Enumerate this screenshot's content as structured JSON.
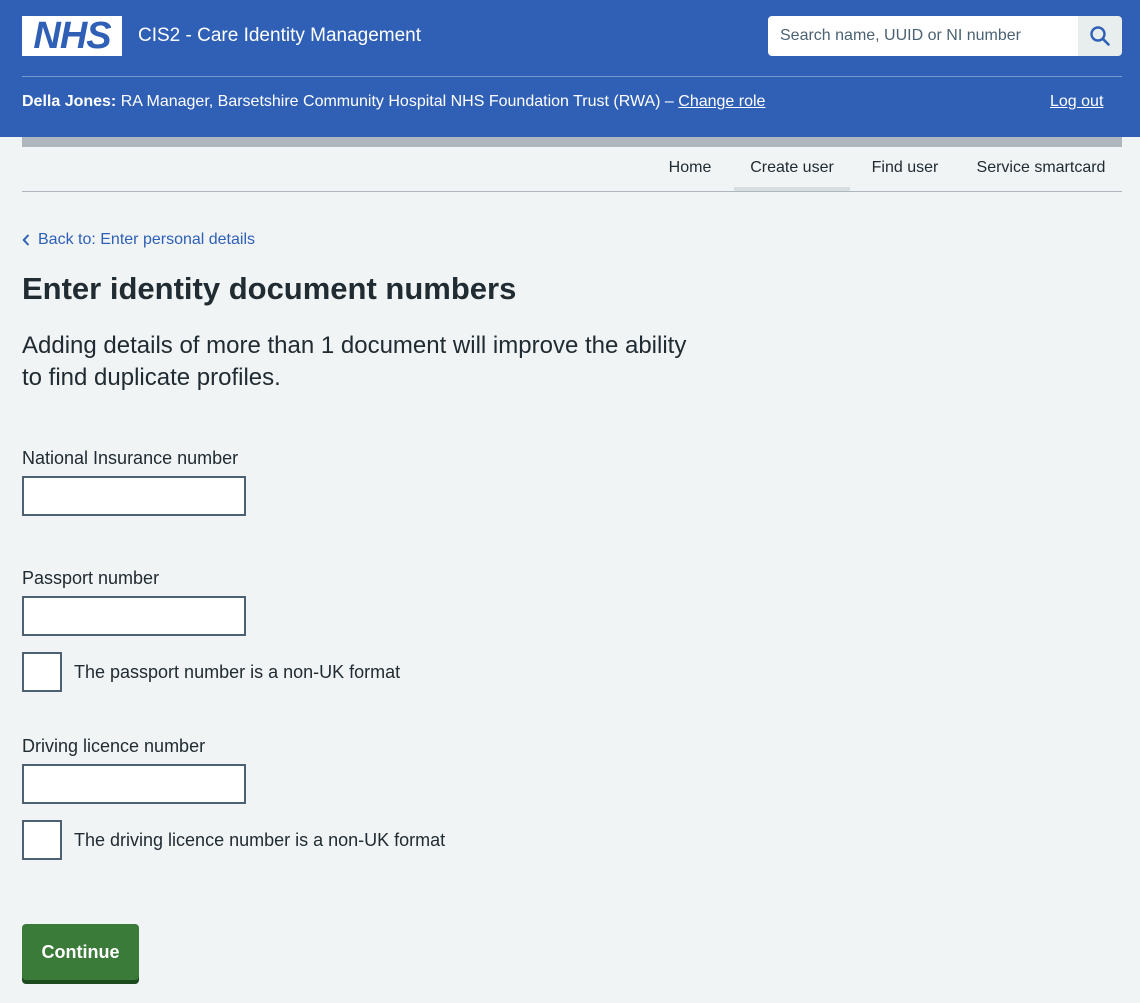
{
  "header": {
    "logo_text": "NHS",
    "service_name": "CIS2 - Care Identity Management",
    "search": {
      "placeholder": "Search name, UUID or NI number",
      "icon": "search-icon"
    },
    "user_name": "Della Jones:",
    "user_role": " RA Manager, Barsetshire Community Hospital NHS Foundation Trust (RWA) – ",
    "change_role_label": "Change role",
    "logout_label": "Log out"
  },
  "nav": {
    "items": [
      {
        "label": "Home",
        "active": false
      },
      {
        "label": "Create user",
        "active": true
      },
      {
        "label": "Find user",
        "active": false
      },
      {
        "label": "Service smartcard",
        "active": false
      }
    ]
  },
  "main": {
    "back_link": "Back to: Enter personal details",
    "title": "Enter identity document numbers",
    "lead": "Adding details of more than 1 document will improve the ability to find duplicate profiles.",
    "fields": {
      "ni": {
        "label": "National Insurance number",
        "value": ""
      },
      "passport": {
        "label": "Passport number",
        "value": "",
        "checkbox_label": "The passport number is a non-UK format",
        "checked": false
      },
      "driving": {
        "label": "Driving licence number",
        "value": "",
        "checkbox_label": "The driving licence number is a non-UK format",
        "checked": false
      }
    },
    "continue_label": "Continue"
  },
  "colors": {
    "brand_blue": "#2f60b6",
    "page_background": "#f0f4f5",
    "button_green": "#3a7b3a",
    "input_border": "#4c6272"
  }
}
